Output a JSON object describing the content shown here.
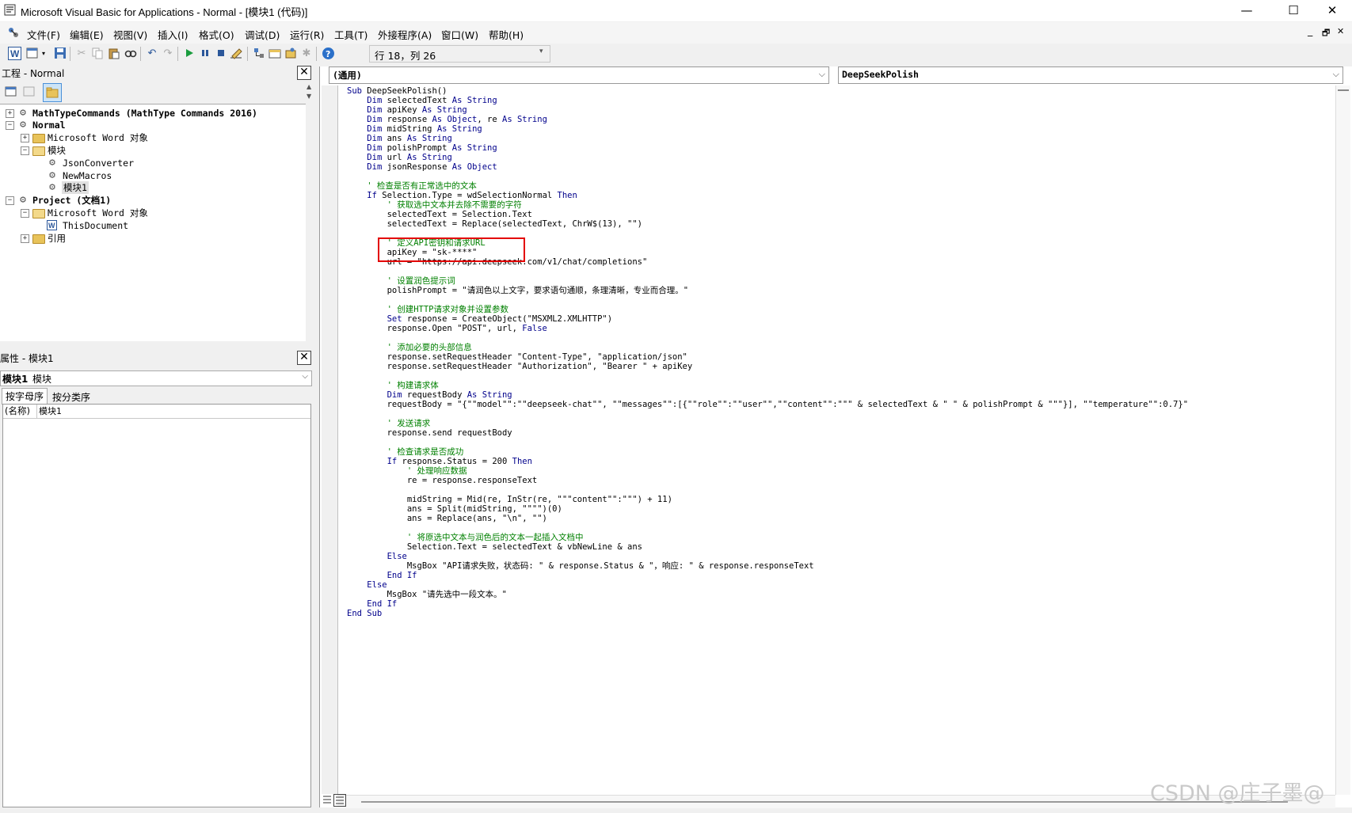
{
  "window": {
    "title": "Microsoft Visual Basic for Applications - Normal - [模块1 (代码)]",
    "minimize": "—",
    "maximize": "☐",
    "close": "✕"
  },
  "mdi": {
    "minimize": "_",
    "restore": "🗗",
    "close": "✕"
  },
  "menu": {
    "items": [
      "文件(F)",
      "编辑(E)",
      "视图(V)",
      "插入(I)",
      "格式(O)",
      "调试(D)",
      "运行(R)",
      "工具(T)",
      "外接程序(A)",
      "窗口(W)",
      "帮助(H)"
    ]
  },
  "toolbar": {
    "position": "行 18，列 26"
  },
  "project": {
    "title": "工程 - Normal",
    "tree": [
      {
        "label": "MathTypeCommands (MathType Commands 2016)",
        "bold": true
      },
      {
        "label": "Normal",
        "bold": true
      },
      {
        "label": "Microsoft Word 对象"
      },
      {
        "label": "模块"
      },
      {
        "label": "JsonConverter"
      },
      {
        "label": "NewMacros"
      },
      {
        "label": "模块1"
      },
      {
        "label": "Project (文档1)",
        "bold": true
      },
      {
        "label": "Microsoft Word 对象"
      },
      {
        "label": "ThisDocument"
      },
      {
        "label": "引用"
      }
    ]
  },
  "properties": {
    "title": "属性 - 模块1",
    "object_name": "模块1",
    "object_type": "模块",
    "tab_alpha": "按字母序",
    "tab_category": "按分类序",
    "row_name": "(名称)",
    "row_value": "模块1"
  },
  "code_window": {
    "object_combo": "(通用)",
    "proc_combo": "DeepSeekPolish",
    "lines": [
      [
        {
          "t": "Sub",
          "c": "kw"
        },
        {
          "t": " DeepSeekPolish()"
        }
      ],
      [
        {
          "t": "    "
        },
        {
          "t": "Dim",
          "c": "kw"
        },
        {
          "t": " selectedText "
        },
        {
          "t": "As String",
          "c": "kw"
        }
      ],
      [
        {
          "t": "    "
        },
        {
          "t": "Dim",
          "c": "kw"
        },
        {
          "t": " apiKey "
        },
        {
          "t": "As String",
          "c": "kw"
        }
      ],
      [
        {
          "t": "    "
        },
        {
          "t": "Dim",
          "c": "kw"
        },
        {
          "t": " response "
        },
        {
          "t": "As Object",
          "c": "kw"
        },
        {
          "t": ", re "
        },
        {
          "t": "As String",
          "c": "kw"
        }
      ],
      [
        {
          "t": "    "
        },
        {
          "t": "Dim",
          "c": "kw"
        },
        {
          "t": " midString "
        },
        {
          "t": "As String",
          "c": "kw"
        }
      ],
      [
        {
          "t": "    "
        },
        {
          "t": "Dim",
          "c": "kw"
        },
        {
          "t": " ans "
        },
        {
          "t": "As String",
          "c": "kw"
        }
      ],
      [
        {
          "t": "    "
        },
        {
          "t": "Dim",
          "c": "kw"
        },
        {
          "t": " polishPrompt "
        },
        {
          "t": "As String",
          "c": "kw"
        }
      ],
      [
        {
          "t": "    "
        },
        {
          "t": "Dim",
          "c": "kw"
        },
        {
          "t": " url "
        },
        {
          "t": "As String",
          "c": "kw"
        }
      ],
      [
        {
          "t": "    "
        },
        {
          "t": "Dim",
          "c": "kw"
        },
        {
          "t": " jsonResponse "
        },
        {
          "t": "As Object",
          "c": "kw"
        }
      ],
      [
        {
          "t": ""
        }
      ],
      [
        {
          "t": "    ' 检查是否有正常选中的文本",
          "c": "cm"
        }
      ],
      [
        {
          "t": "    "
        },
        {
          "t": "If",
          "c": "kw"
        },
        {
          "t": " Selection.Type = wdSelectionNormal "
        },
        {
          "t": "Then",
          "c": "kw"
        }
      ],
      [
        {
          "t": "        ' 获取选中文本并去除不需要的字符",
          "c": "cm"
        }
      ],
      [
        {
          "t": "        selectedText = Selection.Text"
        }
      ],
      [
        {
          "t": "        selectedText = Replace(selectedText, ChrW$(13), \"\")"
        }
      ],
      [
        {
          "t": ""
        }
      ],
      [
        {
          "t": "        ' 定义API密钥和请求URL",
          "c": "cm"
        }
      ],
      [
        {
          "t": "        apiKey = \"sk-****\""
        }
      ],
      [
        {
          "t": "        url = \"https://api.deepseek.com/v1/chat/completions\""
        }
      ],
      [
        {
          "t": ""
        }
      ],
      [
        {
          "t": "        ' 设置润色提示词",
          "c": "cm"
        }
      ],
      [
        {
          "t": "        polishPrompt = \"请润色以上文字，要求语句通顺，条理清晰，专业而合理。\""
        }
      ],
      [
        {
          "t": ""
        }
      ],
      [
        {
          "t": "        ' 创建HTTP请求对象并设置参数",
          "c": "cm"
        }
      ],
      [
        {
          "t": "        "
        },
        {
          "t": "Set",
          "c": "kw"
        },
        {
          "t": " response = CreateObject(\"MSXML2.XMLHTTP\")"
        }
      ],
      [
        {
          "t": "        response.Open \"POST\", url, "
        },
        {
          "t": "False",
          "c": "kw"
        }
      ],
      [
        {
          "t": ""
        }
      ],
      [
        {
          "t": "        ' 添加必要的头部信息",
          "c": "cm"
        }
      ],
      [
        {
          "t": "        response.setRequestHeader \"Content-Type\", \"application/json\""
        }
      ],
      [
        {
          "t": "        response.setRequestHeader \"Authorization\", \"Bearer \" + apiKey"
        }
      ],
      [
        {
          "t": ""
        }
      ],
      [
        {
          "t": "        ' 构建请求体",
          "c": "cm"
        }
      ],
      [
        {
          "t": "        "
        },
        {
          "t": "Dim",
          "c": "kw"
        },
        {
          "t": " requestBody "
        },
        {
          "t": "As String",
          "c": "kw"
        }
      ],
      [
        {
          "t": "        requestBody = \"{\"\"model\"\":\"\"deepseek-chat\"\", \"\"messages\"\":[{\"\"role\"\":\"\"user\"\",\"\"content\"\":\"\"\" & selectedText & \" \" & polishPrompt & \"\"\"}], \"\"temperature\"\":0.7}\""
        }
      ],
      [
        {
          "t": ""
        }
      ],
      [
        {
          "t": "        ' 发送请求",
          "c": "cm"
        }
      ],
      [
        {
          "t": "        response.send requestBody"
        }
      ],
      [
        {
          "t": ""
        }
      ],
      [
        {
          "t": "        ' 检查请求是否成功",
          "c": "cm"
        }
      ],
      [
        {
          "t": "        "
        },
        {
          "t": "If",
          "c": "kw"
        },
        {
          "t": " response.Status = 200 "
        },
        {
          "t": "Then",
          "c": "kw"
        }
      ],
      [
        {
          "t": "            ' 处理响应数据",
          "c": "cm"
        }
      ],
      [
        {
          "t": "            re = response.responseText"
        }
      ],
      [
        {
          "t": ""
        }
      ],
      [
        {
          "t": "            midString = Mid(re, InStr(re, \"\"\"content\"\":\"\"\") + 11)"
        }
      ],
      [
        {
          "t": "            ans = Split(midString, \"\"\"\")(0)"
        }
      ],
      [
        {
          "t": "            ans = Replace(ans, \"\\n\", \"\")"
        }
      ],
      [
        {
          "t": ""
        }
      ],
      [
        {
          "t": "            ' 将原选中文本与润色后的文本一起插入文档中",
          "c": "cm"
        }
      ],
      [
        {
          "t": "            Selection.Text = selectedText & vbNewLine & ans"
        }
      ],
      [
        {
          "t": "        "
        },
        {
          "t": "Else",
          "c": "kw"
        }
      ],
      [
        {
          "t": "            MsgBox \"API请求失败，状态码: \" & response.Status & \"，响应: \" & response.responseText"
        }
      ],
      [
        {
          "t": "        "
        },
        {
          "t": "End If",
          "c": "kw"
        }
      ],
      [
        {
          "t": "    "
        },
        {
          "t": "Else",
          "c": "kw"
        }
      ],
      [
        {
          "t": "        MsgBox \"请先选中一段文本。\""
        }
      ],
      [
        {
          "t": "    "
        },
        {
          "t": "End If",
          "c": "kw"
        }
      ],
      [
        {
          "t": "End Sub",
          "c": "kw"
        }
      ]
    ]
  },
  "watermark": "CSDN @庄子墨@",
  "colors": {
    "keyword": "#00008b",
    "comment": "#008000",
    "highlight_box": "#e30000"
  }
}
